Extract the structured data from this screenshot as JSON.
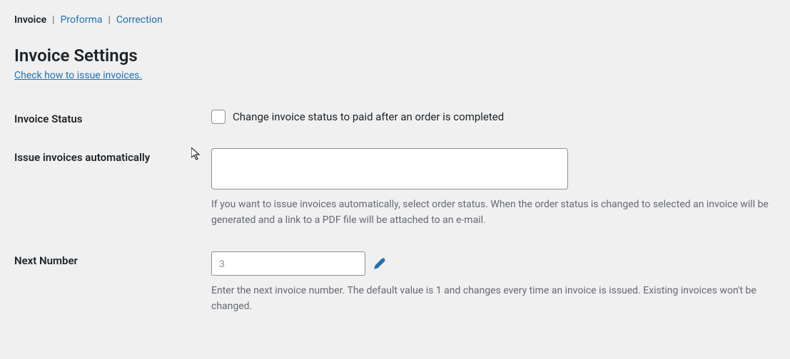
{
  "tabs": {
    "invoice": "Invoice",
    "proforma": "Proforma",
    "correction": "Correction"
  },
  "page": {
    "title": "Invoice Settings",
    "help_link": "Check how to issue invoices."
  },
  "fields": {
    "invoice_status": {
      "label": "Invoice Status",
      "checkbox_label": "Change invoice status to paid after an order is completed",
      "checked": false
    },
    "issue_auto": {
      "label": "Issue invoices automatically",
      "value": "",
      "description": "If you want to issue invoices automatically, select order status. When the order status is changed to selected an invoice will be generated and a link to a PDF file will be attached to an e-mail."
    },
    "next_number": {
      "label": "Next Number",
      "value": "3",
      "description": "Enter the next invoice number. The default value is 1 and changes every time an invoice is issued. Existing invoices won't be changed."
    }
  }
}
